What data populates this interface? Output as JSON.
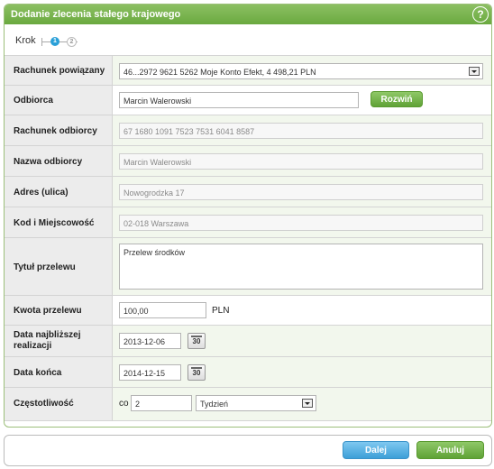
{
  "title": "Dodanie zlecenia stałego krajowego",
  "help_icon": "?",
  "steps": {
    "label": "Krok",
    "current": "1",
    "next": "2"
  },
  "fields": {
    "rachunek_powiazany": {
      "label": "Rachunek powiązany",
      "value": "46...2972 9621 5262 Moje Konto Efekt, 4 498,21 PLN"
    },
    "odbiorca": {
      "label": "Odbiorca",
      "value": "Marcin Walerowski",
      "button": "Rozwiń"
    },
    "rachunek_odbiorcy": {
      "label": "Rachunek odbiorcy",
      "value": "67 1680 1091 7523 7531 6041 8587"
    },
    "nazwa_odbiorcy": {
      "label": "Nazwa odbiorcy",
      "value": "Marcin Walerowski"
    },
    "adres": {
      "label": "Adres (ulica)",
      "value": "Nowogrodzka 17"
    },
    "kod": {
      "label": "Kod i Miejscowość",
      "value": "02-018 Warszawa"
    },
    "tytul": {
      "label": "Tytuł przelewu",
      "value": "Przelew środków"
    },
    "kwota": {
      "label": "Kwota przelewu",
      "value": "100,00",
      "currency": "PLN"
    },
    "data_najblizsza": {
      "label_line1": "Data najbliższej",
      "label_line2": "realizacji",
      "value": "2013-12-06",
      "cal": "30"
    },
    "data_konca": {
      "label": "Data końca",
      "value": "2014-12-15",
      "cal": "30"
    },
    "czestotliwosc": {
      "label": "Częstotliwość",
      "prefix": "co",
      "value": "2",
      "unit": "Tydzień"
    }
  },
  "footer": {
    "next": "Dalej",
    "cancel": "Anuluj"
  }
}
